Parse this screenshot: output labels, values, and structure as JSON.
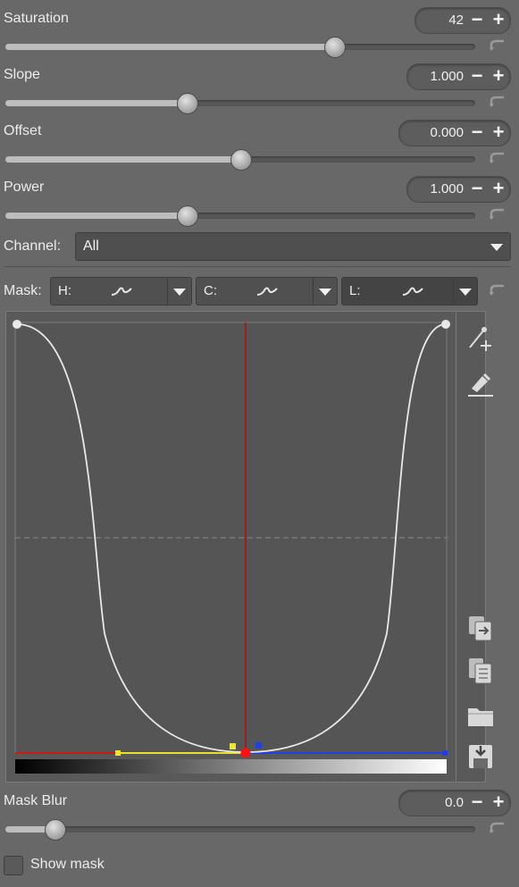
{
  "sliders": [
    {
      "label": "Saturation",
      "value": "42",
      "fraction": 0.7
    },
    {
      "label": "Slope",
      "value": "1.000",
      "fraction": 0.385
    },
    {
      "label": "Offset",
      "value": "0.000",
      "fraction": 0.5
    },
    {
      "label": "Power",
      "value": "1.000",
      "fraction": 0.385
    }
  ],
  "spin_controls": {
    "minus": "−",
    "plus": "+"
  },
  "channel": {
    "label": "Channel:",
    "value": "All"
  },
  "mask": {
    "label": "Mask:",
    "combos": [
      {
        "letter": "H:",
        "active": false
      },
      {
        "letter": "C:",
        "active": false
      },
      {
        "letter": "L:",
        "active": true
      }
    ]
  },
  "curve_editor": {
    "curve_color": "#e8e8e8",
    "vertical_line_color": "#b01010",
    "side_icons": [
      "add-point-icon",
      "pick-point-icon",
      "copy-icon",
      "paste-icon",
      "open-icon",
      "save-icon"
    ]
  },
  "mask_blur": {
    "label": "Mask Blur",
    "value": "0.0",
    "fraction": 0.105
  },
  "show_mask": {
    "label": "Show mask",
    "checked": false
  }
}
